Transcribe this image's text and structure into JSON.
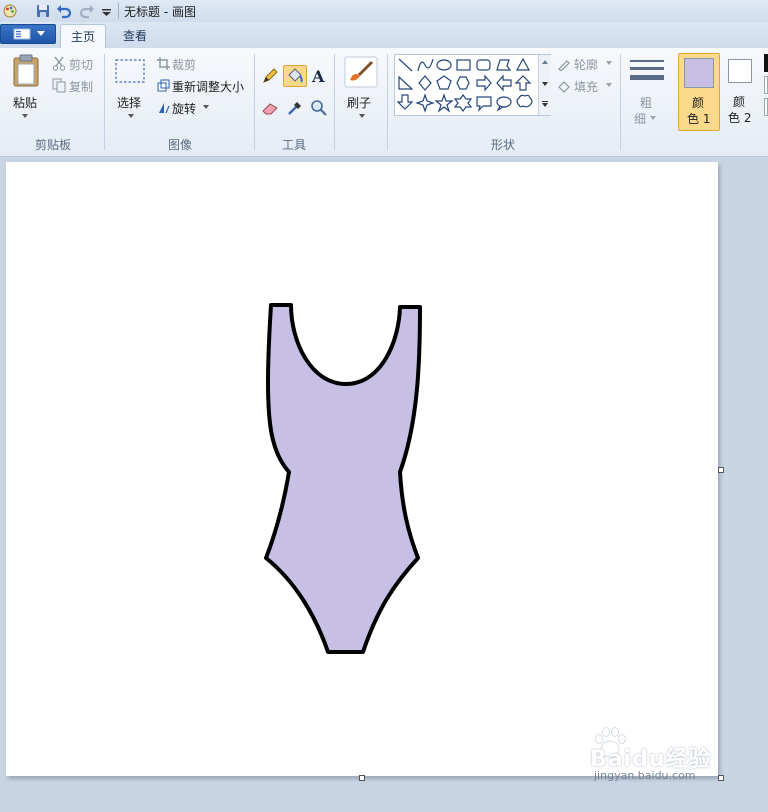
{
  "window": {
    "title": "无标题 - 画图"
  },
  "tabs": {
    "home_label": "主页",
    "view_label": "查看"
  },
  "ribbon": {
    "clipboard": {
      "group_label": "剪贴板",
      "paste_label": "粘贴",
      "cut_label": "剪切",
      "copy_label": "复制"
    },
    "image": {
      "group_label": "图像",
      "select_label": "选择",
      "crop_label": "裁剪",
      "resize_label": "重新调整大小",
      "rotate_label": "旋转"
    },
    "tools": {
      "group_label": "工具"
    },
    "brushes": {
      "label": "刷子"
    },
    "shapes": {
      "group_label": "形状",
      "outline_label": "轮廓",
      "fill_label": "填充"
    },
    "size": {
      "label_line1": "粗",
      "label_line2": "细"
    },
    "colors": {
      "color1_line1": "颜",
      "color1_line2": "色 1",
      "color2_line1": "颜",
      "color2_line2": "色 2",
      "color1_value": "#c8c0e4",
      "color2_value": "#ffffff"
    }
  },
  "watermark": {
    "brand": "Baidu经验",
    "url": "jingyan.baidu.com"
  },
  "colors": {
    "accent_active": "#fbd98a",
    "swimsuit_fill": "#c8c0e4",
    "swimsuit_outline": "#000000"
  }
}
